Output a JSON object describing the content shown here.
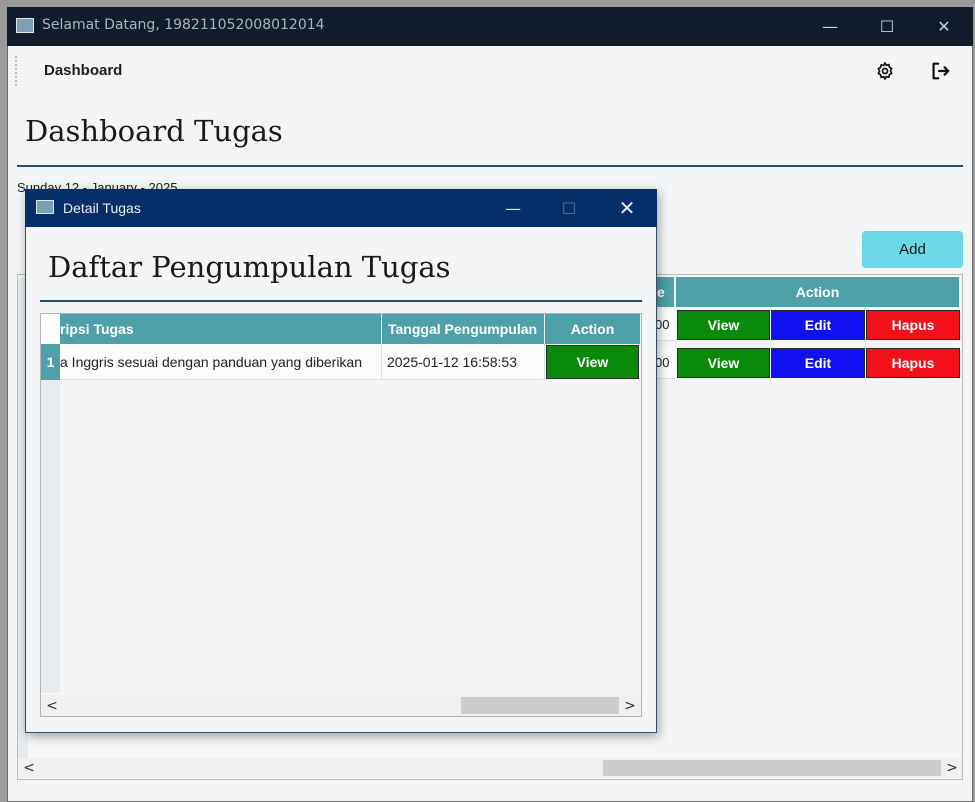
{
  "main_window": {
    "title": "Selamat Datang, 198211052008012014",
    "controls": {
      "minimize": "—",
      "maximize": "☐",
      "close": "✕"
    }
  },
  "toolbar": {
    "dashboard_label": "Dashboard",
    "icons": [
      "gear-icon",
      "logout-icon"
    ]
  },
  "page": {
    "title": "Dashboard Tugas",
    "date": "Sunday 12 - January - 2025",
    "add_label": "Add"
  },
  "main_table": {
    "columns": [
      "e",
      "Action"
    ],
    "rows": [
      {
        "partial": "00",
        "actions": [
          "View",
          "Edit",
          "Hapus"
        ]
      },
      {
        "partial": "00",
        "actions": [
          "View",
          "Edit",
          "Hapus"
        ]
      }
    ]
  },
  "dialog": {
    "title": "Detail Tugas",
    "controls": {
      "minimize": "—",
      "maximize": "☐",
      "close": "✕"
    },
    "heading": "Daftar Pengumpulan Tugas",
    "table": {
      "columns": [
        "ripsi Tugas",
        "Tanggal Pengumpulan",
        "Action"
      ],
      "rows": [
        {
          "number": "1",
          "description": "a Inggris sesuai dengan panduan yang diberikan",
          "date": "2025-01-12 16:58:53",
          "action": "View"
        }
      ]
    }
  },
  "scroll": {
    "left": "<",
    "right": ">"
  },
  "colors": {
    "header_teal": "#4ea1a8",
    "view_green": "#0a8a0a",
    "edit_blue": "#1010f0",
    "hapus_red": "#f2101a",
    "add_cyan": "#6ad8e6",
    "dialog_titlebar": "#062f6a"
  }
}
